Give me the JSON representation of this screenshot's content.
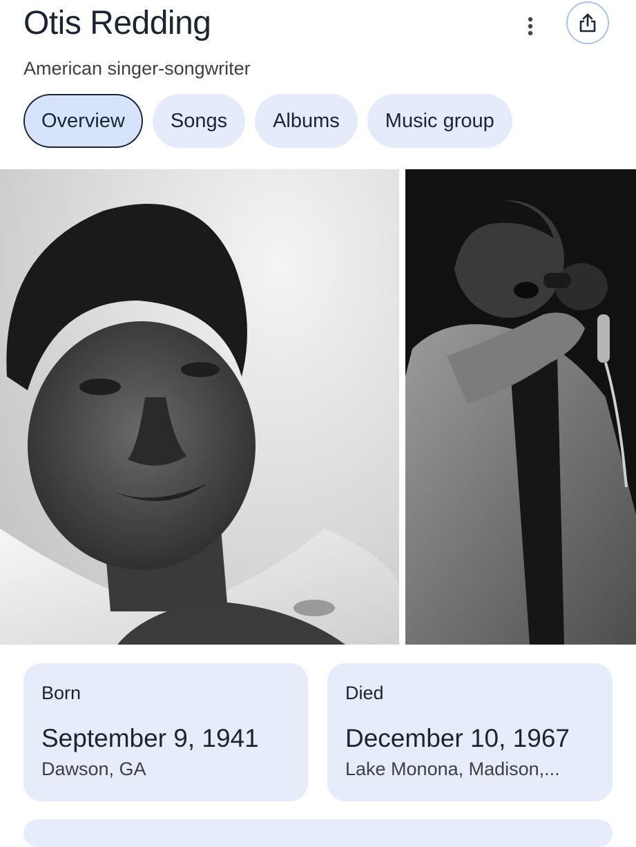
{
  "header": {
    "title": "Otis Redding",
    "subtitle": "American singer-songwriter",
    "more_icon": "more-vert-icon",
    "share_icon": "share-icon"
  },
  "tabs": [
    {
      "label": "Overview",
      "active": true
    },
    {
      "label": "Songs",
      "active": false
    },
    {
      "label": "Albums",
      "active": false
    },
    {
      "label": "Music group",
      "active": false
    }
  ],
  "facts": {
    "born": {
      "label": "Born",
      "date": "September 9, 1941",
      "place": "Dawson, GA"
    },
    "died": {
      "label": "Died",
      "date": "December 10, 1967",
      "place": "Lake Monona, Madison,..."
    }
  },
  "colors": {
    "chip_bg": "#e5ebfa",
    "chip_active_bg": "#d7e3fb",
    "card_bg": "#e6ecfa",
    "text_dark": "#1b2433",
    "share_border": "#a8c3ea"
  }
}
